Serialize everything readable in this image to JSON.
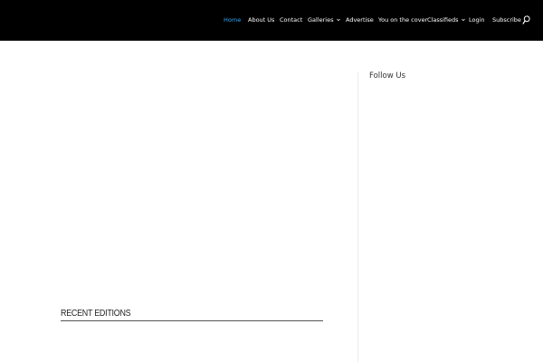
{
  "header": {
    "background": "#000000",
    "nav": [
      {
        "label": "Home",
        "active": true,
        "dropdown": false
      },
      {
        "label": "About Us",
        "active": false,
        "dropdown": false
      },
      {
        "label": "Contact",
        "active": false,
        "dropdown": false
      },
      {
        "label": "Galleries",
        "active": false,
        "dropdown": true
      },
      {
        "label": "Advertise",
        "active": false,
        "dropdown": false
      },
      {
        "label": "You on the cover",
        "active": false,
        "dropdown": false
      },
      {
        "label": "Classifieds",
        "active": false,
        "dropdown": true
      },
      {
        "label": "Login",
        "active": false,
        "dropdown": false
      },
      {
        "label": "Subscribe",
        "active": false,
        "dropdown": false
      }
    ],
    "active_color": "#3da2e6",
    "search_icon": "search-icon"
  },
  "sidebar": {
    "title": "Follow Us"
  },
  "main": {
    "section_title": "RECENT EDITIONS"
  }
}
